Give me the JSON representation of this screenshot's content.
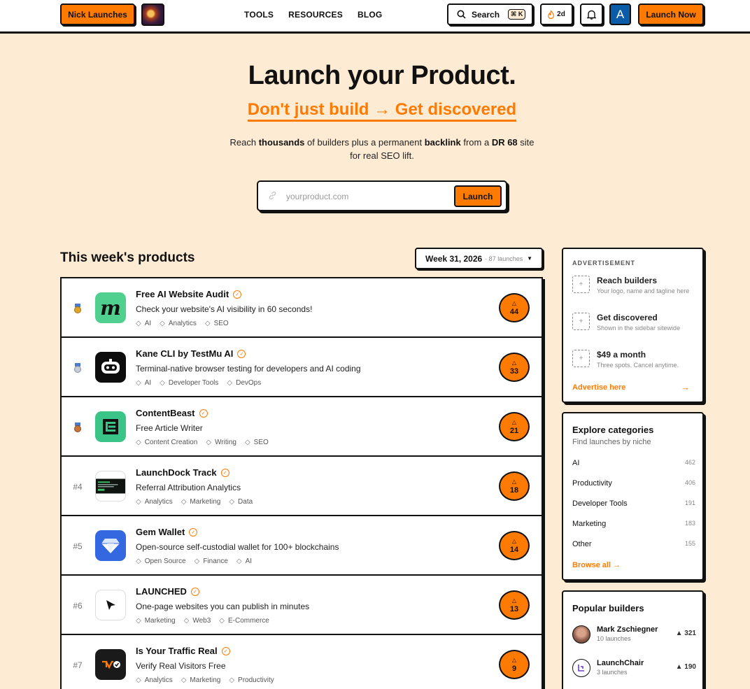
{
  "header": {
    "brand_label": "Nick Launches",
    "nav": [
      "TOOLS",
      "RESOURCES",
      "BLOG"
    ],
    "search_label": "Search",
    "search_shortcut": "⌘ K",
    "streak_label": "2d",
    "user_initial": "A",
    "launch_now_label": "Launch Now"
  },
  "hero": {
    "title": "Launch your Product.",
    "subtitle": "Don't just build → Get discovered",
    "desc_parts": [
      "Reach ",
      "thousands",
      " of builders plus a permanent ",
      "backlink",
      " from a ",
      "DR 68",
      " site"
    ],
    "desc_line2": "for real SEO lift.",
    "input_placeholder": "yourproduct.com",
    "launch_label": "Launch"
  },
  "products": {
    "section_title": "This week's products",
    "week_label": "Week 31, 2026",
    "week_meta": "· 87 launches",
    "items": [
      {
        "rank": "",
        "medal": "gold",
        "name": "Free AI Website Audit",
        "tagline": "Check your website's AI visibility in 60 seconds!",
        "tags": [
          "AI",
          "Analytics",
          "SEO"
        ],
        "votes": "44",
        "logo": "m"
      },
      {
        "rank": "",
        "medal": "silver",
        "name": "Kane CLI by TestMu AI",
        "tagline": "Terminal-native browser testing for developers and AI coding",
        "tags": [
          "AI",
          "Developer Tools",
          "DevOps"
        ],
        "votes": "33",
        "logo": "robot"
      },
      {
        "rank": "",
        "medal": "bronze",
        "name": "ContentBeast",
        "tagline": "Free Article Writer",
        "tags": [
          "Content Creation",
          "Writing",
          "SEO"
        ],
        "votes": "21",
        "logo": "E"
      },
      {
        "rank": "#4",
        "medal": "",
        "name": "LaunchDock Track",
        "tagline": "Referral Attribution Analytics",
        "tags": [
          "Analytics",
          "Marketing",
          "Data"
        ],
        "votes": "18",
        "logo": "dash"
      },
      {
        "rank": "#5",
        "medal": "",
        "name": "Gem Wallet",
        "tagline": "Open-source self-custodial wallet for 100+ blockchains",
        "tags": [
          "Open Source",
          "Finance",
          "AI"
        ],
        "votes": "14",
        "logo": "gem"
      },
      {
        "rank": "#6",
        "medal": "",
        "name": "LAUNCHED",
        "tagline": "One-page websites you can publish in minutes",
        "tags": [
          "Marketing",
          "Web3",
          "E-Commerce"
        ],
        "votes": "13",
        "logo": "cursor"
      },
      {
        "rank": "#7",
        "medal": "",
        "name": "Is Your Traffic Real",
        "tagline": "Verify Real Visitors Free",
        "tags": [
          "Analytics",
          "Marketing",
          "Productivity"
        ],
        "votes": "9",
        "logo": "traffic"
      }
    ]
  },
  "ad": {
    "label": "ADVERTISEMENT",
    "items": [
      {
        "title": "Reach builders",
        "desc": "Your logo, name and tagline here"
      },
      {
        "title": "Get discovered",
        "desc": "Shown in the sidebar sitewide"
      },
      {
        "title": "$49 a month",
        "desc": "Three spots. Cancel anytime."
      }
    ],
    "cta": "Advertise here"
  },
  "categories": {
    "title": "Explore categories",
    "subtitle": "Find launches by niche",
    "items": [
      {
        "name": "AI",
        "count": "462"
      },
      {
        "name": "Productivity",
        "count": "406"
      },
      {
        "name": "Developer Tools",
        "count": "191"
      },
      {
        "name": "Marketing",
        "count": "183"
      },
      {
        "name": "Other",
        "count": "155"
      }
    ],
    "browse_label": "Browse all →"
  },
  "builders": {
    "title": "Popular builders",
    "items": [
      {
        "name": "Mark Zschiegner",
        "meta": "10 launches",
        "votes": "▲ 321"
      },
      {
        "name": "LaunchChair",
        "meta": "3 launches",
        "votes": "▲ 190"
      }
    ]
  },
  "colors": {
    "accent": "#ff7a00",
    "background": "#fdebd3",
    "ink": "#111111"
  }
}
